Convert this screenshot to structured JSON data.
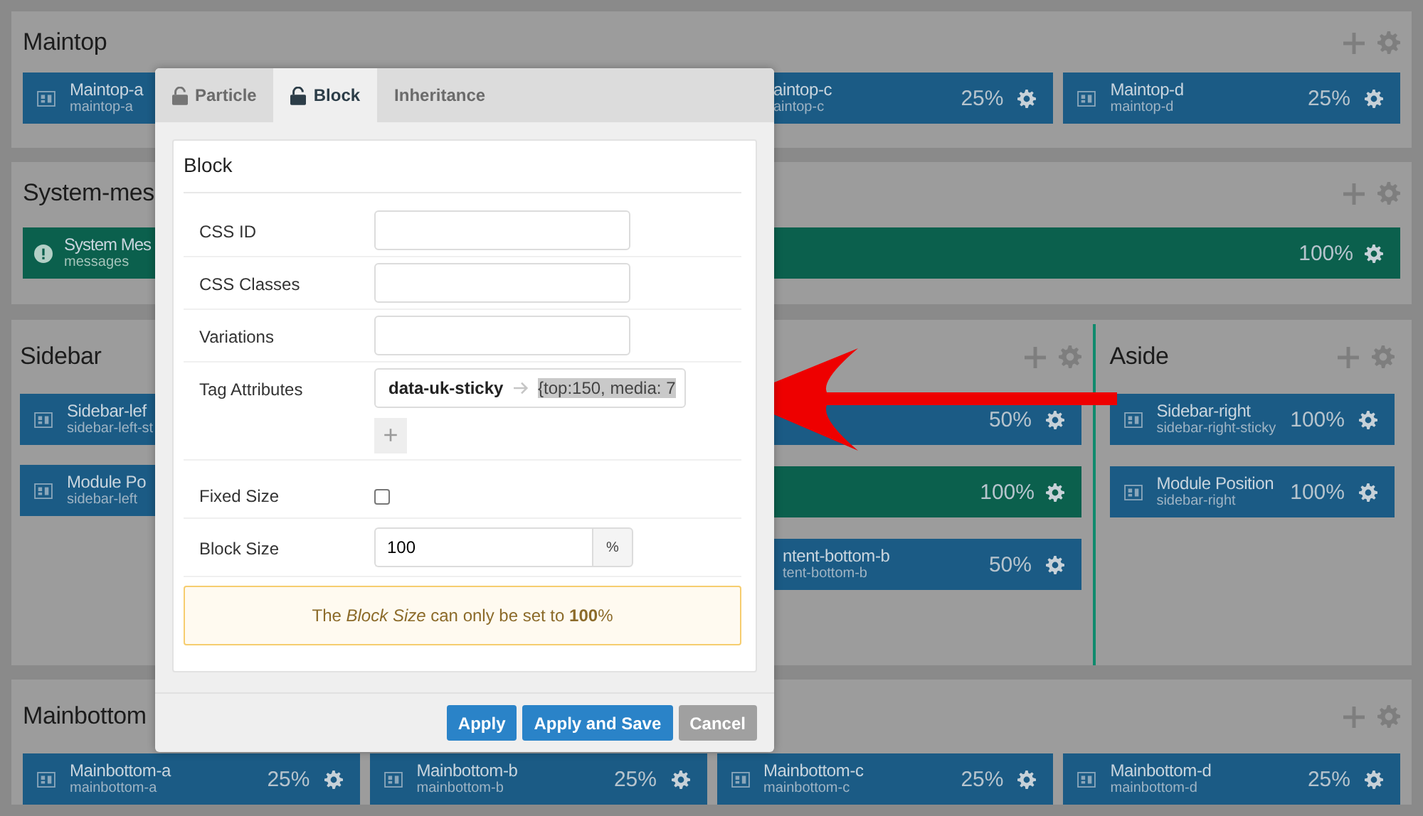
{
  "sections": [
    {
      "kind": "quarters",
      "title": "Maintop",
      "cards": [
        {
          "kind": "position",
          "clipped": false,
          "title": "Maintop-a",
          "subtitle": "maintop-a"
        },
        {
          "kind": "position",
          "clipped": true,
          "title": "aintop-c",
          "subtitle": "aintop-c",
          "size": "25%"
        },
        {
          "kind": "position",
          "clipped": false,
          "title": "Maintop-d",
          "subtitle": "maintop-d",
          "size": "25%"
        }
      ]
    },
    {
      "kind": "full",
      "title": "System-mes",
      "cards": [
        {
          "kind": "message",
          "clipped": false,
          "title": "System Mes",
          "subtitle": "messages",
          "size": "100%"
        }
      ]
    },
    {
      "kind": "columns",
      "title": "Sidebar",
      "sidebar_cards": [
        {
          "kind": "position",
          "clipped": false,
          "title": "Sidebar-lef",
          "subtitle": "sidebar-left-st"
        },
        {
          "kind": "position",
          "clipped": false,
          "title": "Module Po",
          "subtitle": "sidebar-left"
        }
      ],
      "content_rows": [
        {
          "kind": "halves",
          "cards": [
            {
              "kind": "position",
              "clipped": true,
              "size": "50%"
            }
          ]
        },
        {
          "kind": "full",
          "cards": [
            {
              "kind": "message",
              "size": "100%"
            }
          ]
        },
        {
          "kind": "halves",
          "cards": [
            {
              "kind": "position",
              "clipped": true,
              "title": "ntent-bottom-b",
              "subtitle": "tent-bottom-b",
              "size": "50%"
            }
          ]
        }
      ],
      "aside": {
        "title": "Aside",
        "cards": [
          {
            "kind": "position",
            "clipped": false,
            "title": "Sidebar-right",
            "subtitle": "sidebar-right-sticky",
            "size": "100%"
          },
          {
            "kind": "position",
            "clipped": false,
            "title": "Module Position",
            "subtitle": "sidebar-right",
            "size": "100%"
          }
        ]
      }
    },
    {
      "kind": "quarters",
      "title": "Mainbottom",
      "cards": [
        {
          "kind": "position",
          "clipped": false,
          "title": "Mainbottom-a",
          "subtitle": "mainbottom-a",
          "size": "25%"
        },
        {
          "kind": "position",
          "clipped": false,
          "title": "Mainbottom-b",
          "subtitle": "mainbottom-b",
          "size": "25%"
        },
        {
          "kind": "position",
          "clipped": false,
          "title": "Mainbottom-c",
          "subtitle": "mainbottom-c",
          "size": "25%"
        },
        {
          "kind": "position",
          "clipped": false,
          "title": "Mainbottom-d",
          "subtitle": "mainbottom-d",
          "size": "25%"
        }
      ]
    }
  ],
  "modal": {
    "tabs": [
      {
        "label": "Particle",
        "kind": "locked",
        "selected": false
      },
      {
        "label": "Block",
        "kind": "locked",
        "selected": true
      },
      {
        "label": "Inheritance",
        "kind": "plain",
        "selected": false
      }
    ],
    "panel_title": "Block",
    "fields": [
      {
        "kind": "text",
        "label": "CSS ID"
      },
      {
        "kind": "text",
        "label": "CSS Classes"
      },
      {
        "kind": "text",
        "label": "Variations"
      },
      {
        "kind": "attributes",
        "label": "Tag Attributes",
        "key": "data-uk-sticky",
        "value": "{top:150, media: 7",
        "add": "+"
      },
      {
        "kind": "checkbox",
        "label": "Fixed Size",
        "checked": false
      },
      {
        "kind": "unit",
        "label": "Block Size",
        "value": "100",
        "unit": "%"
      }
    ],
    "notice": "The *Block Size* can only be set to **100**%",
    "buttons": [
      {
        "label": "Apply",
        "kind": "primary"
      },
      {
        "label": "Apply and Save",
        "kind": "primary"
      },
      {
        "label": "Cancel",
        "kind": "secondary"
      }
    ]
  }
}
